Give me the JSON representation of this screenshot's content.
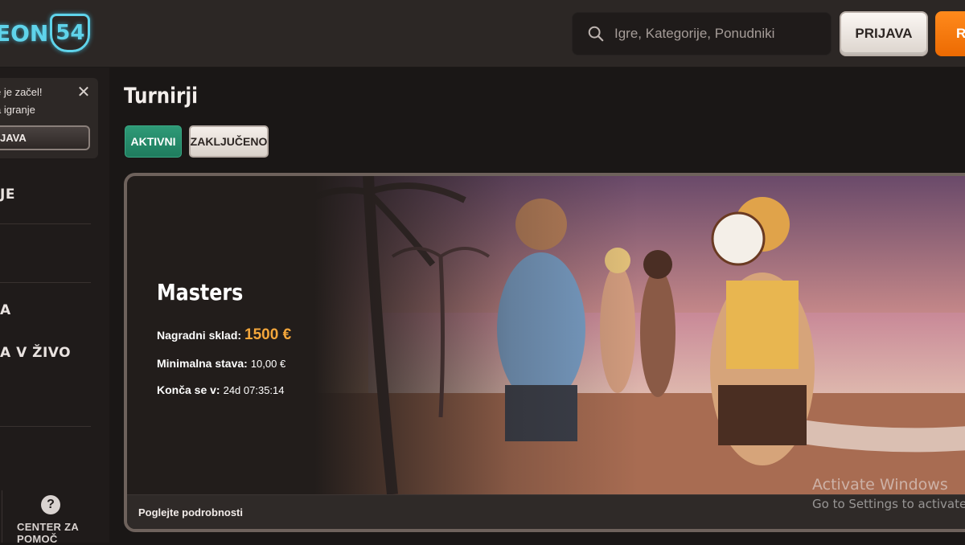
{
  "header": {
    "logo_text": "EON",
    "logo_number": "54",
    "search_placeholder": "Igre, Kategorije, Ponudniki",
    "login_label": "PRIJAVA",
    "register_label": "R"
  },
  "sidebar": {
    "welcome_line1": "e je začel!",
    "welcome_line2": "a igranje",
    "welcome_button": "JAVA",
    "items": [
      {
        "label": "JE"
      },
      {
        "label": "A"
      },
      {
        "label": "A V ŽIVO"
      }
    ],
    "help_label": "CENTER ZA POMOČ"
  },
  "main": {
    "title": "Turnirji",
    "tabs": [
      {
        "label": "AKTIVNI",
        "active": true
      },
      {
        "label": "ZAKLJUČENO",
        "active": false
      }
    ]
  },
  "tournament": {
    "name": "Masters",
    "prize_label": "Nagradni sklad:",
    "prize_value": "1500 €",
    "min_bet_label": "Minimalna stava:",
    "min_bet_value": "10,00 €",
    "ends_label": "Konča se v:",
    "ends_value": "24d 07:35:14",
    "details_link": "Poglejte podrobnosti"
  },
  "watermark": {
    "line1": "Activate Windows",
    "line2": "Go to Settings to activate"
  },
  "colors": {
    "accent_orange": "#ec6a02",
    "active_tab_green": "#1f7c5e",
    "prize_gold": "#f3a63b",
    "logo_cyan": "#5fd3ea"
  }
}
